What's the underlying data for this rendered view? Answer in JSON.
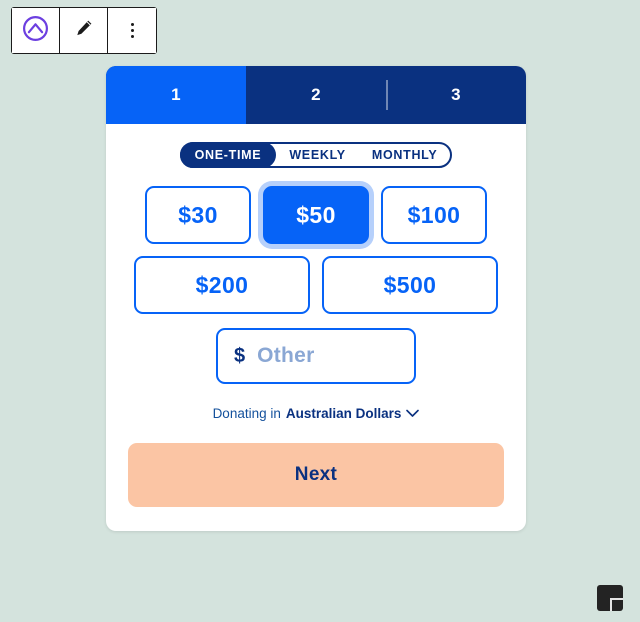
{
  "theme": {
    "page_background": "#d4e3dd",
    "brand_blue": "#0663f7",
    "brand_navy": "#0a3180",
    "accent_peach": "#fbc5a4",
    "focus_ring": "#b6d0fb",
    "logo_purple": "#6c3fe0"
  },
  "toolbar": {
    "logo_icon": "circle-chevron-up-icon",
    "edit_icon": "pencil-icon",
    "more_icon": "more-vertical-icon"
  },
  "widget": {
    "steps": [
      {
        "label": "1",
        "active": true
      },
      {
        "label": "2",
        "active": false
      },
      {
        "label": "3",
        "active": false
      }
    ],
    "frequency": {
      "selected": "ONE-TIME",
      "options": [
        "ONE-TIME",
        "WEEKLY",
        "MONTHLY"
      ]
    },
    "amounts": [
      {
        "label": "$30",
        "selected": false
      },
      {
        "label": "$50",
        "selected": true
      },
      {
        "label": "$100",
        "selected": false
      },
      {
        "label": "$200",
        "selected": false
      },
      {
        "label": "$500",
        "selected": false
      }
    ],
    "other": {
      "currency_symbol": "$",
      "value": "",
      "placeholder": "Other"
    },
    "currency": {
      "label": "Donating in",
      "value": "Australian Dollars",
      "chevron_icon": "chevron-down-icon"
    },
    "next_label": "Next"
  },
  "canvas": {
    "add_icon": "plus-icon"
  }
}
